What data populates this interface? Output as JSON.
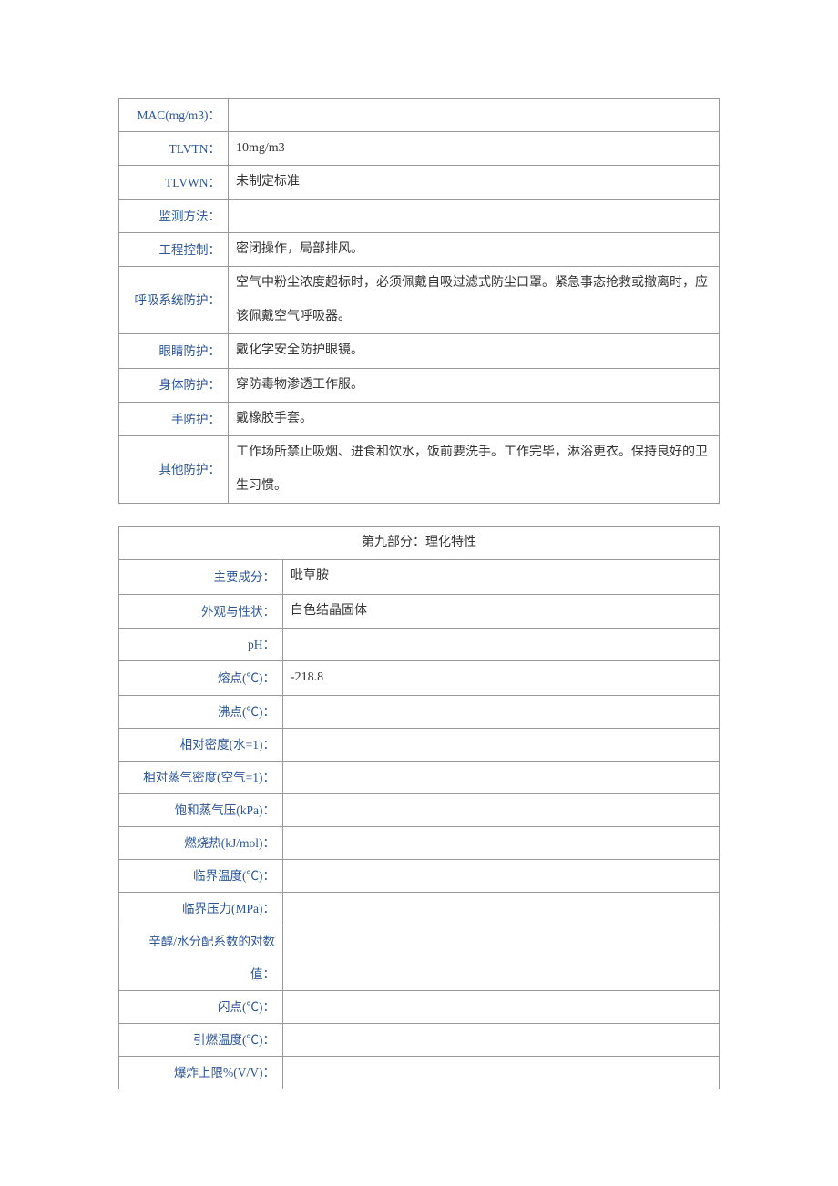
{
  "table1": {
    "rows": [
      {
        "label": "MAC(mg/m3)：",
        "value": ""
      },
      {
        "label": "TLVTN：",
        "value": "10mg/m3"
      },
      {
        "label": "TLVWN：",
        "value": "未制定标准"
      },
      {
        "label": "监测方法：",
        "value": ""
      },
      {
        "label": "工程控制：",
        "value": "密闭操作，局部排风。"
      },
      {
        "label": "呼吸系统防护：",
        "value": "空气中粉尘浓度超标时，必须佩戴自吸过滤式防尘口罩。紧急事态抢救或撤离时，应该佩戴空气呼吸器。"
      },
      {
        "label": "眼睛防护：",
        "value": "戴化学安全防护眼镜。"
      },
      {
        "label": "身体防护：",
        "value": "穿防毒物渗透工作服。"
      },
      {
        "label": "手防护：",
        "value": "戴橡胶手套。"
      },
      {
        "label": "其他防护：",
        "value": "工作场所禁止吸烟、进食和饮水，饭前要洗手。工作完毕，淋浴更衣。保持良好的卫生习惯。"
      }
    ]
  },
  "table2": {
    "header": "第九部分：理化特性",
    "rows": [
      {
        "label": "主要成分：",
        "value": "吡草胺"
      },
      {
        "label": "外观与性状：",
        "value": "白色结晶固体"
      },
      {
        "label": "pH：",
        "value": ""
      },
      {
        "label": "熔点(℃)：",
        "value": "-218.8"
      },
      {
        "label": "沸点(℃)：",
        "value": ""
      },
      {
        "label": "相对密度(水=1)：",
        "value": ""
      },
      {
        "label": "相对蒸气密度(空气=1)：",
        "value": ""
      },
      {
        "label": "饱和蒸气压(kPa)：",
        "value": ""
      },
      {
        "label": "燃烧热(kJ/mol)：",
        "value": ""
      },
      {
        "label": "临界温度(℃)：",
        "value": ""
      },
      {
        "label": "临界压力(MPa)：",
        "value": ""
      },
      {
        "label": "辛醇/水分配系数的对数值：",
        "value": ""
      },
      {
        "label": "闪点(℃)：",
        "value": ""
      },
      {
        "label": "引燃温度(℃)：",
        "value": ""
      },
      {
        "label": "爆炸上限%(V/V)：",
        "value": ""
      }
    ]
  }
}
